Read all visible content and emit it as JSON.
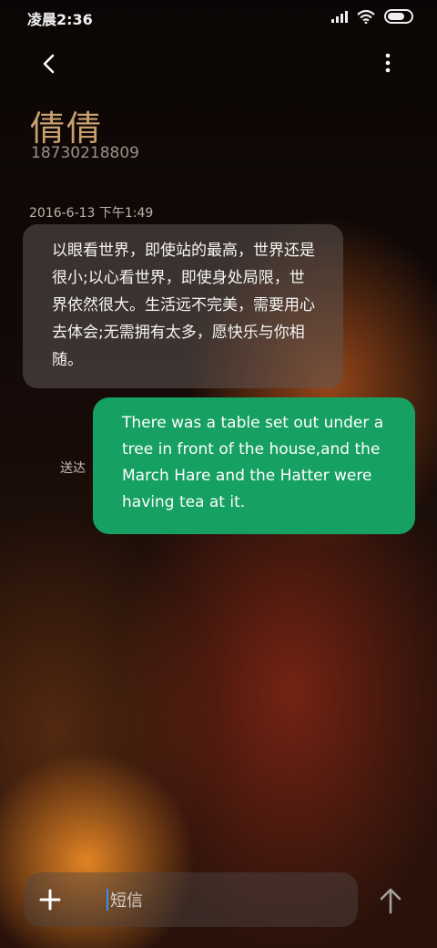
{
  "status_bar": {
    "time": "凌晨2:36"
  },
  "header": {
    "back_icon": "chevron-left-icon",
    "more_icon": "more-vertical-icon",
    "contact_name": "倩倩",
    "contact_number": "18730218809"
  },
  "thread": {
    "timestamp": "2016-6-13 下午1:49",
    "incoming_message": "以眼看世界，即使站的最高，世界还是很小;以心看世界，即使身处局限，世界依然很大。生活远不完美，需要用心去体会;无需拥有太多，愿快乐与你相随。",
    "outgoing_message": "There was a table set out under a tree in front of the house,and the March Hare and the Hatter were having tea at it.",
    "delivery_status": "送达"
  },
  "composer": {
    "placeholder": "短信",
    "add_icon": "plus-icon",
    "send_icon": "arrow-up-icon"
  },
  "colors": {
    "sent_bubble": "#16a061",
    "contact_name": "#c89f6e"
  }
}
